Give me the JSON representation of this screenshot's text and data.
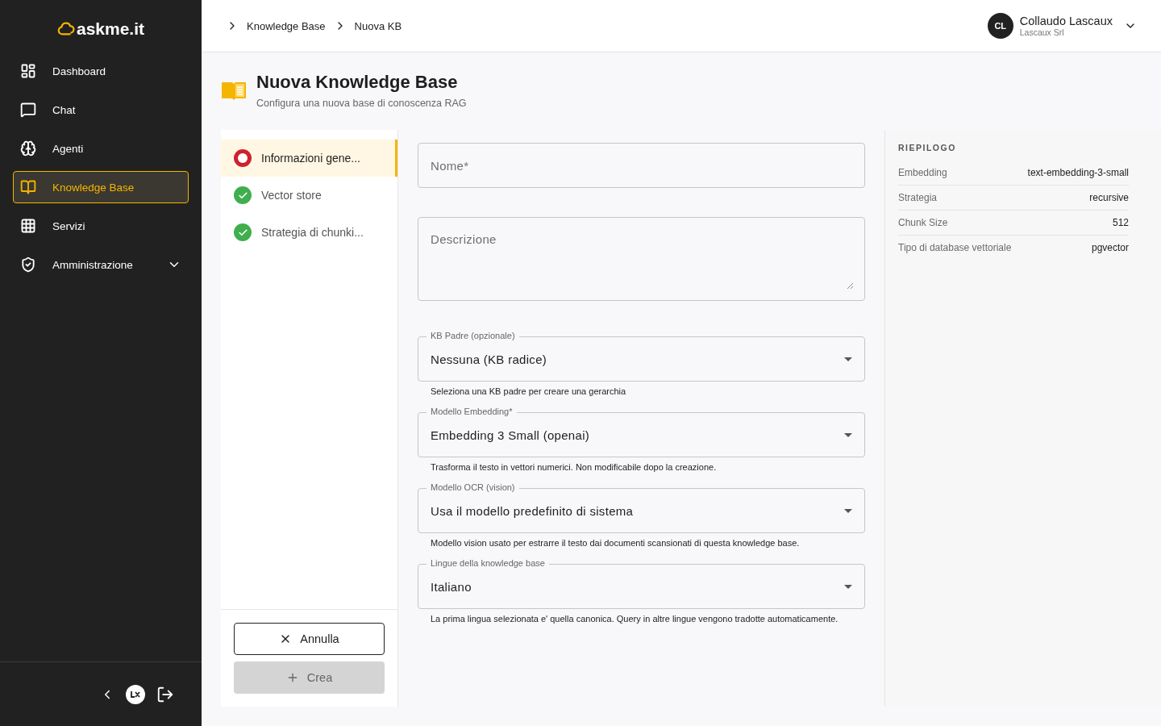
{
  "sidebar": {
    "logo": "askme.it",
    "items": [
      {
        "kind": "dashboard",
        "label": "Dashboard",
        "selected": false
      },
      {
        "kind": "chat",
        "label": "Chat",
        "selected": false
      },
      {
        "kind": "agents",
        "label": "Agenti",
        "selected": false
      },
      {
        "kind": "book",
        "label": "Knowledge Base",
        "selected": true
      },
      {
        "kind": "grid",
        "label": "Servizi",
        "selected": false
      },
      {
        "kind": "admin",
        "label": "Amministrazione",
        "selected": false,
        "expandable": true
      }
    ]
  },
  "breadcrumb": [
    "Knowledge Base",
    "Nuova KB"
  ],
  "user": {
    "initials": "CL",
    "name": "Collaudo Lascaux",
    "company": "Lascaux Srl"
  },
  "page": {
    "title": "Nuova Knowledge Base",
    "subtitle": "Configura una nuova base di conoscenza RAG"
  },
  "steps": [
    {
      "label": "Informazioni gene...",
      "kind": "error",
      "selected": true
    },
    {
      "label": "Vector store",
      "kind": "done",
      "selected": false
    },
    {
      "label": "Strategia di chunki...",
      "kind": "done",
      "selected": false
    }
  ],
  "actions": [
    {
      "kind": "cancel",
      "label": "Annulla",
      "disabled": false
    },
    {
      "kind": "create",
      "label": "Crea",
      "disabled": true
    }
  ],
  "form": {
    "fields": [
      {
        "kind": "text",
        "placeholder": "Nome*"
      },
      {
        "kind": "textarea",
        "placeholder": "Descrizione"
      },
      {
        "kind": "select",
        "label": "KB Padre (opzionale)",
        "value": "Nessuna (KB radice)",
        "help": "Seleziona una KB padre per creare una gerarchia"
      },
      {
        "kind": "select",
        "label": "Modello Embedding*",
        "value": "Embedding 3 Small (openai)",
        "help": "Trasforma il testo in vettori numerici. Non modificabile dopo la creazione."
      },
      {
        "kind": "select",
        "label": "Modello OCR (vision)",
        "value": "Usa il modello predefinito di sistema",
        "help": "Modello vision usato per estrarre il testo dai documenti scansionati di questa knowledge base."
      },
      {
        "kind": "select",
        "label": "Lingue della knowledge base",
        "value": "Italiano",
        "help": "La prima lingua selezionata e' quella canonica. Query in altre lingue vengono tradotte automaticamente."
      }
    ]
  },
  "summary": {
    "title": "RIEPILOGO",
    "rows": [
      {
        "label": "Embedding",
        "value": "text-embedding-3-small"
      },
      {
        "label": "Strategia",
        "value": "recursive"
      },
      {
        "label": "Chunk Size",
        "value": "512"
      },
      {
        "label": "Tipo di database vettoriale",
        "value": "pgvector"
      }
    ]
  }
}
